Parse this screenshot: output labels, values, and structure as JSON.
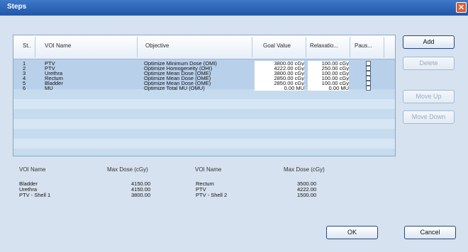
{
  "window": {
    "title": "Steps",
    "close_glyph": "✕"
  },
  "grid": {
    "headers": {
      "step": "St..",
      "voi_name": "VOI Name",
      "objective": "Objective",
      "goal_value": "Goal Value",
      "relaxation": "Relaxatio...",
      "pause": "Paus..."
    },
    "rows": [
      {
        "step": "1",
        "voi_name": "PTV",
        "objective": "Optimize Minimum Dose (OMI)",
        "goal_value": "3800.00 cGy",
        "relaxation": "100.00 cGy",
        "pause": false
      },
      {
        "step": "2",
        "voi_name": "PTV",
        "objective": "Optimize Homogeneity (OHI)",
        "goal_value": "4222.00 cGy",
        "relaxation": "250.00 cGy",
        "pause": false
      },
      {
        "step": "3",
        "voi_name": "Urethra",
        "objective": "Optimize Mean Dose (OME)",
        "goal_value": "3800.00 cGy",
        "relaxation": "100.00 cGy",
        "pause": false
      },
      {
        "step": "4",
        "voi_name": "Rectum",
        "objective": "Optimize Mean Dose (OME)",
        "goal_value": "2850.00 cGy",
        "relaxation": "100.00 cGy",
        "pause": false
      },
      {
        "step": "5",
        "voi_name": "Bladder",
        "objective": "Optimize Mean Dose (OME)",
        "goal_value": "2850.00 cGy",
        "relaxation": "100.00 cGy",
        "pause": false
      },
      {
        "step": "6",
        "voi_name": "MU",
        "objective": "Optimize Total MU (OMU)",
        "goal_value": "0.00 MU",
        "relaxation": "0.00 MU",
        "pause": false
      }
    ]
  },
  "buttons": {
    "add": "Add",
    "delete": "Delete",
    "move_up": "Move Up",
    "move_down": "Move Down",
    "ok": "OK",
    "cancel": "Cancel"
  },
  "max_dose": {
    "left": {
      "header_voi": "VOI Name",
      "header_dose": "Max Dose (cGy)",
      "rows": [
        {
          "voi": "Bladder",
          "dose": "4150.00"
        },
        {
          "voi": "Urethra",
          "dose": "4150.00"
        },
        {
          "voi": "PTV - Shell 1",
          "dose": "3800.00"
        }
      ]
    },
    "right": {
      "header_voi": "VOI Name",
      "header_dose": "Max Dose (cGy)",
      "rows": [
        {
          "voi": "Rectum",
          "dose": "3500.00"
        },
        {
          "voi": "PTV",
          "dose": "4222.00"
        },
        {
          "voi": "PTV - Shell 2",
          "dose": "1500.00"
        }
      ]
    }
  }
}
